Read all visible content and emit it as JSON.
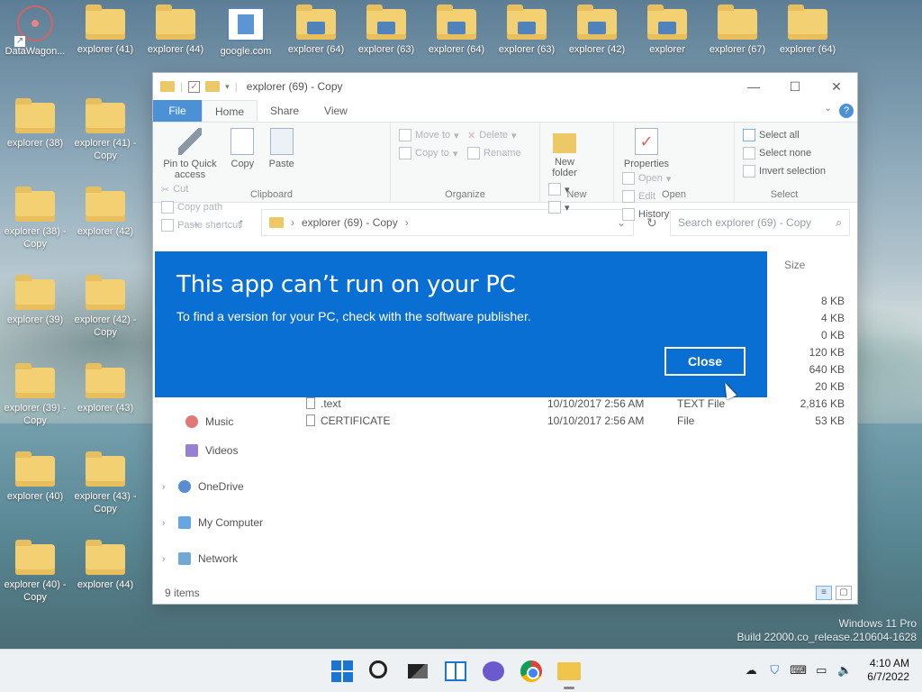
{
  "desktop": {
    "icons": [
      {
        "label": "DataWagon...",
        "type": "app"
      },
      {
        "label": "explorer (41)",
        "type": "folder"
      },
      {
        "label": "explorer (44)",
        "type": "folder"
      },
      {
        "label": "google.com",
        "type": "web"
      },
      {
        "label": "explorer (64)",
        "type": "folder-badge"
      },
      {
        "label": "explorer (63)",
        "type": "folder-badge"
      },
      {
        "label": "explorer (64)",
        "type": "folder-badge"
      },
      {
        "label": "explorer (63)",
        "type": "folder-badge"
      },
      {
        "label": "explorer (42)",
        "type": "folder-badge"
      },
      {
        "label": "explorer",
        "type": "folder-badge"
      },
      {
        "label": "explorer (67)",
        "type": "folder"
      },
      {
        "label": "explorer (64)",
        "type": "folder"
      },
      {
        "label": "explorer (38)",
        "type": "folder"
      },
      {
        "label": "explorer (41) - Copy",
        "type": "folder"
      },
      {
        "label": "explorer (38) - Copy",
        "type": "folder"
      },
      {
        "label": "explorer (42)",
        "type": "folder"
      },
      {
        "label": "explorer (39)",
        "type": "folder"
      },
      {
        "label": "explorer (42) - Copy",
        "type": "folder"
      },
      {
        "label": "explorer (39) - Copy",
        "type": "folder"
      },
      {
        "label": "explorer (43)",
        "type": "folder"
      },
      {
        "label": "explorer (40)",
        "type": "folder"
      },
      {
        "label": "explorer (43) - Copy",
        "type": "folder"
      },
      {
        "label": "explorer (40) - Copy",
        "type": "folder"
      },
      {
        "label": "explorer (44)",
        "type": "folder"
      }
    ]
  },
  "window": {
    "title": "explorer (69) - Copy",
    "tabs": {
      "file": "File",
      "home": "Home",
      "share": "Share",
      "view": "View"
    },
    "ribbon": {
      "clipboard": {
        "pin": "Pin to Quick access",
        "copy": "Copy",
        "paste": "Paste",
        "cut": "Cut",
        "copy_path": "Copy path",
        "paste_shortcut": "Paste shortcut",
        "name": "Clipboard"
      },
      "organize": {
        "move_to": "Move to",
        "copy_to": "Copy to",
        "delete": "Delete",
        "rename": "Rename",
        "name": "Organize"
      },
      "new": {
        "new_folder": "New folder",
        "name": "New"
      },
      "open": {
        "properties": "Properties",
        "open": "Open",
        "edit": "Edit",
        "history": "History",
        "name": "Open"
      },
      "select": {
        "select_all": "Select all",
        "select_none": "Select none",
        "invert": "Invert selection",
        "name": "Select"
      }
    },
    "address": {
      "path": "explorer (69) - Copy",
      "search_placeholder": "Search explorer (69) - Copy"
    },
    "columns": {
      "size": "Size"
    },
    "sizes": [
      "8 KB",
      "4 KB",
      "0 KB",
      "120 KB",
      "640 KB",
      "20 KB"
    ],
    "files": [
      {
        "name": ".text",
        "date": "10/10/2017 2:56 AM",
        "type": "TEXT File",
        "size": "2,816 KB"
      },
      {
        "name": "CERTIFICATE",
        "date": "10/10/2017 2:56 AM",
        "type": "File",
        "size": "53 KB"
      }
    ],
    "nav": {
      "music": "Music",
      "videos": "Videos",
      "onedrive": "OneDrive",
      "mycomputer": "My Computer",
      "network": "Network"
    },
    "status": "9 items"
  },
  "dialog": {
    "title": "This app can’t run on your PC",
    "message": "To find a version for your PC, check with the software publisher.",
    "close": "Close"
  },
  "watermark": {
    "line1": "Windows 11 Pro",
    "line2": "Build 22000.co_release.210604-1628"
  },
  "taskbar": {
    "time": "4:10 AM",
    "date": "6/7/2022"
  }
}
